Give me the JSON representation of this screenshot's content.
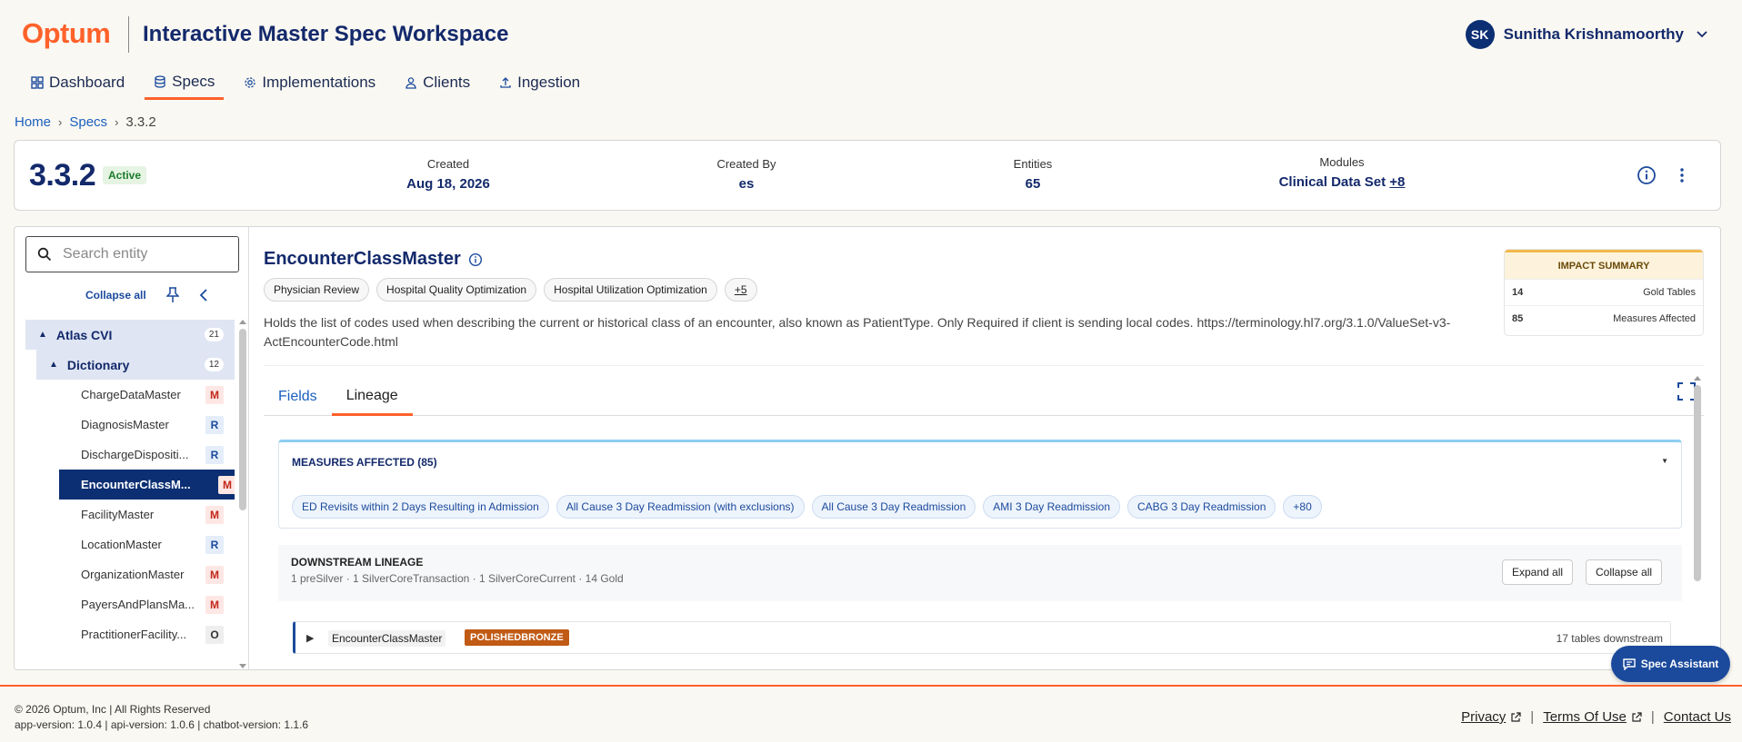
{
  "header": {
    "logo": "Optum",
    "app_title": "Interactive Master Spec Workspace",
    "user_initials": "SK",
    "user_name": "Sunitha Krishnamoorthy"
  },
  "nav": [
    {
      "label": "Dashboard",
      "icon": "grid-icon"
    },
    {
      "label": "Specs",
      "icon": "database-icon",
      "active": true
    },
    {
      "label": "Implementations",
      "icon": "gear-icon"
    },
    {
      "label": "Clients",
      "icon": "user-icon"
    },
    {
      "label": "Ingestion",
      "icon": "upload-icon"
    }
  ],
  "breadcrumb": {
    "home": "Home",
    "specs": "Specs",
    "current": "3.3.2"
  },
  "summary": {
    "version": "3.3.2",
    "status": "Active",
    "created_label": "Created",
    "created_value": "Aug 18, 2026",
    "created_by_label": "Created By",
    "created_by_value": "es",
    "entities_label": "Entities",
    "entities_value": "65",
    "modules_label": "Modules",
    "modules_value": "Clinical Data Set",
    "modules_more": "+8"
  },
  "sidebar": {
    "search_placeholder": "Search entity",
    "collapse_all": "Collapse all",
    "group": {
      "label": "Atlas CVI",
      "count": "21"
    },
    "subgroup": {
      "label": "Dictionary",
      "count": "12"
    },
    "items": [
      {
        "label": "ChargeDataMaster",
        "tag": "M"
      },
      {
        "label": "DiagnosisMaster",
        "tag": "R"
      },
      {
        "label": "DischargeDispositi...",
        "tag": "R"
      },
      {
        "label": "EncounterClassM...",
        "tag": "M",
        "selected": true
      },
      {
        "label": "FacilityMaster",
        "tag": "M"
      },
      {
        "label": "LocationMaster",
        "tag": "R"
      },
      {
        "label": "OrganizationMaster",
        "tag": "M"
      },
      {
        "label": "PayersAndPlansMa...",
        "tag": "M"
      },
      {
        "label": "PractitionerFacility...",
        "tag": "O"
      }
    ]
  },
  "entity": {
    "title": "EncounterClassMaster",
    "chips": [
      "Physician Review",
      "Hospital Quality Optimization",
      "Hospital Utilization Optimization"
    ],
    "chips_more": "+5",
    "description": "Holds the list of codes used when describing the current or historical class of an encounter, also known as PatientType. Only Required if client is sending local codes. https://terminology.hl7.org/3.1.0/ValueSet-v3-ActEncounterCode.html"
  },
  "impact": {
    "title": "IMPACT SUMMARY",
    "rows": [
      {
        "value": "14",
        "label": "Gold Tables"
      },
      {
        "value": "85",
        "label": "Measures Affected"
      }
    ]
  },
  "tabs": [
    {
      "label": "Fields"
    },
    {
      "label": "Lineage",
      "active": true
    }
  ],
  "measures": {
    "title": "MEASURES AFFECTED (85)",
    "chips": [
      "ED Revisits within 2 Days Resulting in Admission",
      "All Cause 3 Day Readmission (with exclusions)",
      "All Cause 3 Day Readmission",
      "AMI 3 Day Readmission",
      "CABG 3 Day Readmission"
    ],
    "more": "+80"
  },
  "downstream": {
    "title": "DOWNSTREAM LINEAGE",
    "subtitle": "1 preSilver · 1 SilverCoreTransaction · 1 SilverCoreCurrent · 14 Gold",
    "expand_all": "Expand all",
    "collapse_all": "Collapse all",
    "row": {
      "name": "EncounterClassMaster",
      "badge": "POLISHEDBRONZE",
      "count": "17 tables downstream"
    }
  },
  "assistant": "Spec Assistant",
  "footer": {
    "copyright": "© 2026 Optum, Inc | All Rights Reserved",
    "versions": "app-version: 1.0.4 | api-version: 1.0.6 | chatbot-version: 1.1.6",
    "privacy": "Privacy",
    "terms": "Terms Of Use",
    "contact": "Contact Us"
  },
  "colors": {
    "brand": "#ff612b",
    "navy": "#13296b",
    "selected": "#0c2f73",
    "link": "#1b5fbf"
  }
}
